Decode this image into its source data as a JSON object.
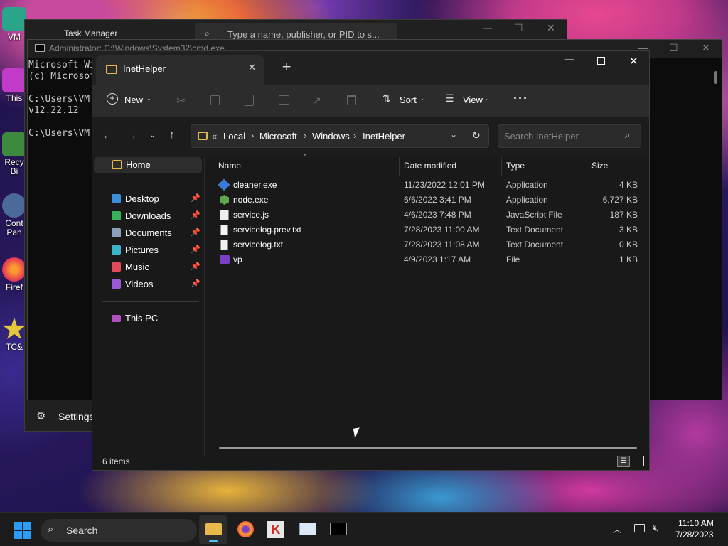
{
  "desktop": {
    "icons": [
      "VM",
      "This",
      "Recy\nBi",
      "Cont\nPan",
      "Firef",
      "TC&"
    ]
  },
  "task_manager": {
    "title": "Task Manager",
    "search_placeholder": "Type a name, publisher, or PID to s...",
    "settings_label": "Settings"
  },
  "cmd": {
    "title": "Administrator: C:\\Windows\\System32\\cmd.exe",
    "lines": [
      "Microsoft Wi",
      "(c) Microsof",
      "",
      "C:\\Users\\VM",
      "v12.22.12",
      "",
      "C:\\Users\\VM"
    ]
  },
  "explorer": {
    "tab_title": "InetHelper",
    "toolbar": {
      "new_label": "New",
      "sort_label": "Sort",
      "view_label": "View"
    },
    "breadcrumb": [
      "Local",
      "Microsoft",
      "Windows",
      "InetHelper"
    ],
    "search_placeholder": "Search InetHelper",
    "nav": {
      "home": "Home",
      "quick": [
        {
          "label": "Desktop",
          "color": "#3b8fd9"
        },
        {
          "label": "Downloads",
          "color": "#38b15a"
        },
        {
          "label": "Documents",
          "color": "#8aa0b8"
        },
        {
          "label": "Pictures",
          "color": "#3bb4c9"
        },
        {
          "label": "Music",
          "color": "#e04b5c"
        },
        {
          "label": "Videos",
          "color": "#9a58d6"
        }
      ],
      "this_pc": "This PC"
    },
    "columns": {
      "name": "Name",
      "date": "Date modified",
      "type": "Type",
      "size": "Size"
    },
    "files": [
      {
        "name": "cleaner.exe",
        "date": "11/23/2022 12:01 PM",
        "type": "Application",
        "size": "4 KB",
        "icon": "exe-icon"
      },
      {
        "name": "node.exe",
        "date": "6/6/2022 3:41 PM",
        "type": "Application",
        "size": "6,727 KB",
        "icon": "node-icon"
      },
      {
        "name": "service.js",
        "date": "4/6/2023 7:48 PM",
        "type": "JavaScript File",
        "size": "187 KB",
        "icon": "js-icon"
      },
      {
        "name": "servicelog.prev.txt",
        "date": "7/28/2023 11:00 AM",
        "type": "Text Document",
        "size": "3 KB",
        "icon": "txt-icon"
      },
      {
        "name": "servicelog.txt",
        "date": "7/28/2023 11:08 AM",
        "type": "Text Document",
        "size": "0 KB",
        "icon": "txt-icon"
      },
      {
        "name": "vp",
        "date": "4/9/2023 1:17 AM",
        "type": "File",
        "size": "1 KB",
        "icon": "file-icon"
      }
    ],
    "status": "6 items"
  },
  "taskbar": {
    "search_label": "Search",
    "time": "11:10 AM",
    "date": "7/28/2023"
  }
}
